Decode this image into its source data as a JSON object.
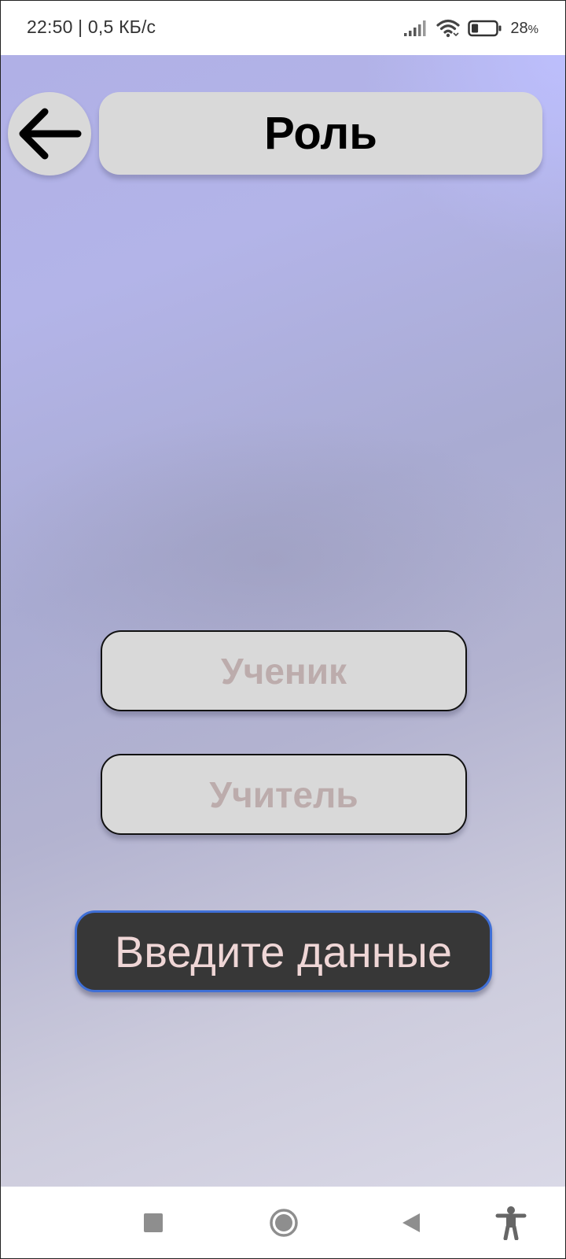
{
  "status_bar": {
    "time_speed": "22:50 | 0,5 КБ/с",
    "battery_percent": "28",
    "battery_unit": "%",
    "battery_level": 0.28,
    "icons": [
      "signal-icon",
      "wifi-icon",
      "battery-icon"
    ]
  },
  "header": {
    "back_icon": "arrow-left-icon",
    "title": "Роль"
  },
  "roles": {
    "student_label": "Ученик",
    "teacher_label": "Учитель"
  },
  "enter_button": {
    "label": "Введите данные"
  },
  "nav_bar": {
    "icons": [
      "recents-square-icon",
      "home-circle-icon",
      "back-triangle-icon",
      "accessibility-icon"
    ]
  },
  "colors": {
    "button_gray": "#d9d9d9",
    "role_text": "#bcacac",
    "enter_bg": "#373737",
    "enter_border": "#3f6fd6",
    "enter_text": "#efd6d6"
  }
}
